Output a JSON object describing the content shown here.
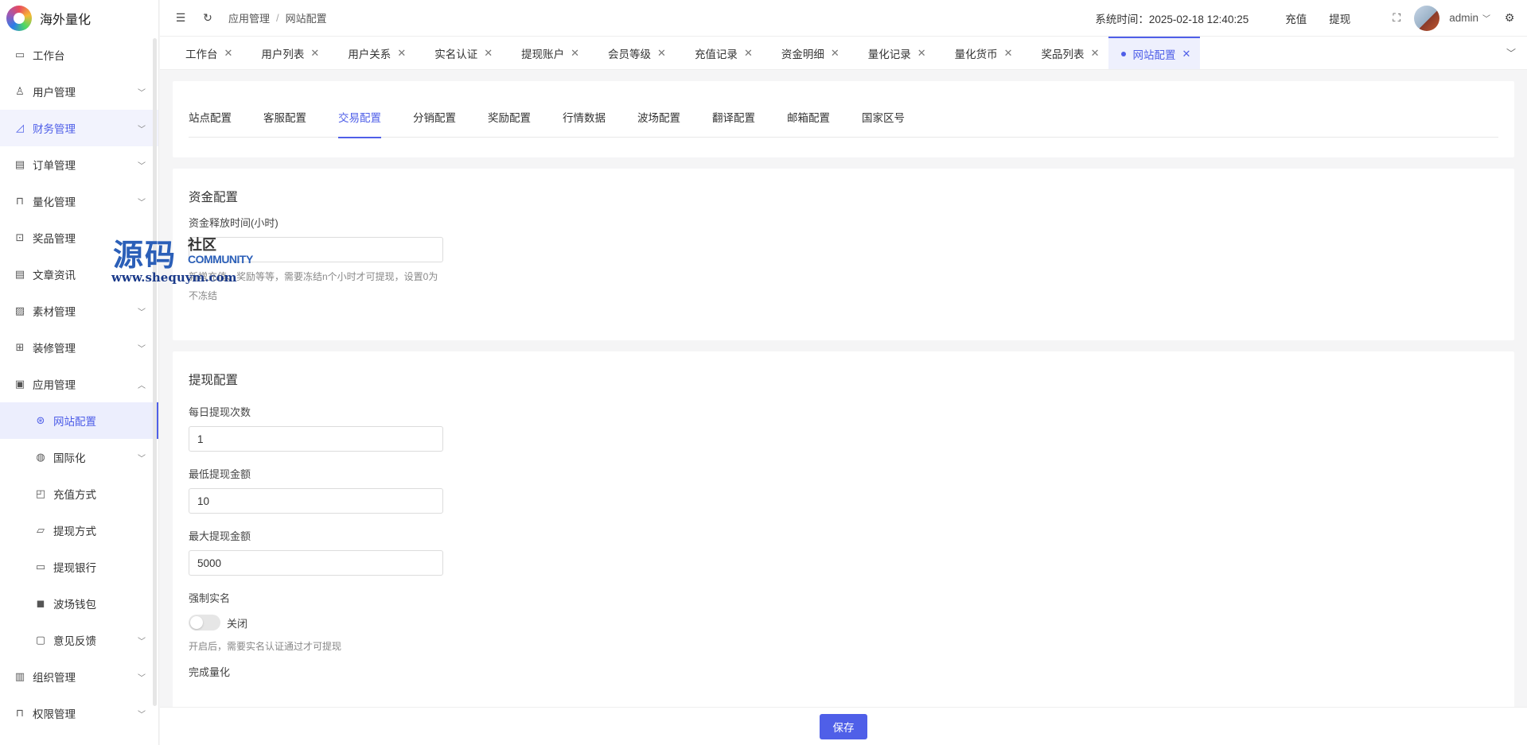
{
  "brand": {
    "name": "海外量化"
  },
  "sidebar": {
    "items": [
      {
        "label": "工作台",
        "icon": "monitor-icon",
        "chevron": false
      },
      {
        "label": "用户管理",
        "icon": "user-icon",
        "chevron": true
      },
      {
        "label": "财务管理",
        "icon": "chart-icon",
        "chevron": true
      },
      {
        "label": "订单管理",
        "icon": "order-icon",
        "chevron": true
      },
      {
        "label": "量化管理",
        "icon": "quant-icon",
        "chevron": true
      },
      {
        "label": "奖品管理",
        "icon": "gift-icon",
        "chevron": false
      },
      {
        "label": "文章资讯",
        "icon": "article-icon",
        "chevron": false
      },
      {
        "label": "素材管理",
        "icon": "image-icon",
        "chevron": true
      },
      {
        "label": "装修管理",
        "icon": "decor-icon",
        "chevron": true
      },
      {
        "label": "应用管理",
        "icon": "app-icon",
        "chevron": true
      }
    ],
    "subitems": [
      {
        "label": "网站配置",
        "icon": "web-icon",
        "chevron": false
      },
      {
        "label": "国际化",
        "icon": "globe-icon",
        "chevron": true
      },
      {
        "label": "充值方式",
        "icon": "wallet-icon",
        "chevron": false
      },
      {
        "label": "提现方式",
        "icon": "folder-icon",
        "chevron": false
      },
      {
        "label": "提现银行",
        "icon": "card-icon",
        "chevron": false
      },
      {
        "label": "波场钱包",
        "icon": "tron-icon",
        "chevron": false
      },
      {
        "label": "意见反馈",
        "icon": "feedback-icon",
        "chevron": true
      }
    ],
    "bottom_items": [
      {
        "label": "组织管理",
        "icon": "org-icon",
        "chevron": true
      },
      {
        "label": "权限管理",
        "icon": "lock-icon",
        "chevron": true
      }
    ]
  },
  "header": {
    "breadcrumb": [
      "应用管理",
      "网站配置"
    ],
    "breadcrumb_sep": "/",
    "system_time": "系统时间：2025-02-18 12:40:25",
    "recharge": "充值",
    "withdraw": "提现",
    "username": "admin"
  },
  "tabs": [
    {
      "label": "工作台",
      "active": false
    },
    {
      "label": "用户列表",
      "active": false
    },
    {
      "label": "用户关系",
      "active": false
    },
    {
      "label": "实名认证",
      "active": false
    },
    {
      "label": "提现账户",
      "active": false
    },
    {
      "label": "会员等级",
      "active": false
    },
    {
      "label": "充值记录",
      "active": false
    },
    {
      "label": "资金明细",
      "active": false
    },
    {
      "label": "量化记录",
      "active": false
    },
    {
      "label": "量化货币",
      "active": false
    },
    {
      "label": "奖品列表",
      "active": false
    },
    {
      "label": "网站配置",
      "active": true
    }
  ],
  "subtabs": [
    "站点配置",
    "客服配置",
    "交易配置",
    "分销配置",
    "奖励配置",
    "行情数据",
    "波场配置",
    "翻译配置",
    "邮箱配置",
    "国家区号"
  ],
  "subtab_active": "交易配置",
  "fund": {
    "title": "资金配置",
    "release_label": "资金释放时间(小时)",
    "release_value": "",
    "release_hint": "新增充值、奖励等等，需要冻结n个小时才可提现，设置0为不冻结"
  },
  "withdraw": {
    "title": "提现配置",
    "daily_count_label": "每日提现次数",
    "daily_count_value": "1",
    "min_label": "最低提现金额",
    "min_value": "10",
    "max_label": "最大提现金额",
    "max_value": "5000",
    "force_real_label": "强制实名",
    "force_real_state": "关闭",
    "force_real_hint": "开启后，需要实名认证通过才可提现",
    "complete_quant_label": "完成量化"
  },
  "footer": {
    "save": "保存"
  },
  "watermark": {
    "big": "源码",
    "small": "社区",
    "community": "COMMUNITY",
    "url": "www.shequym.com"
  },
  "colors": {
    "accent": "#4f5fe8"
  }
}
